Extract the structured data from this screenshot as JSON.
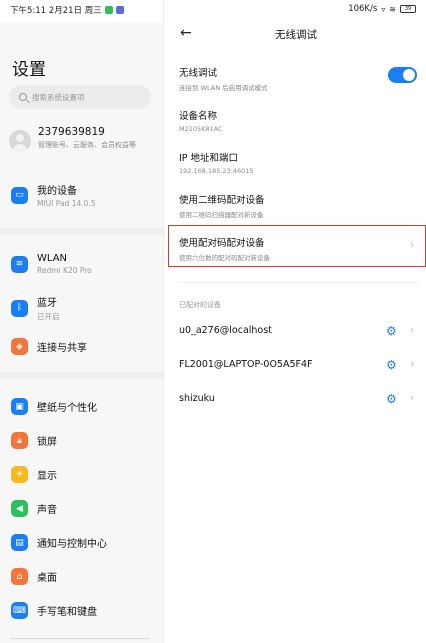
{
  "status": {
    "left": "下午5:11 2月21日 周三",
    "right_speed": "106K/s",
    "battery": "39"
  },
  "left_pane": {
    "title": "设置",
    "search_placeholder": "搜索系统设置项",
    "account": {
      "name": "2379639819",
      "sub": "管理账号、云服务、会员权益等"
    },
    "device": {
      "label": "我的设备",
      "sub": "MIUI Pad 14.0.5"
    },
    "items": [
      {
        "label": "WLAN",
        "sub": "Redmi K20 Pro",
        "icon": "wifi-icon",
        "color": "#1b7ef2"
      },
      {
        "label": "蓝牙",
        "sub": "已开启",
        "icon": "bluetooth-icon",
        "color": "#1b7ef2"
      },
      {
        "label": "连接与共享",
        "sub": "",
        "icon": "share-icon",
        "color": "#f2753a"
      },
      {
        "label": "壁纸与个性化",
        "sub": "",
        "icon": "wallpaper-icon",
        "color": "#1b7ef2"
      },
      {
        "label": "锁屏",
        "sub": "",
        "icon": "lock-icon",
        "color": "#f2753a"
      },
      {
        "label": "显示",
        "sub": "",
        "icon": "sun-icon",
        "color": "#f6b920"
      },
      {
        "label": "声音",
        "sub": "",
        "icon": "speaker-icon",
        "color": "#2fbf5c"
      },
      {
        "label": "通知与控制中心",
        "sub": "",
        "icon": "notification-icon",
        "color": "#1b7ef2"
      },
      {
        "label": "桌面",
        "sub": "",
        "icon": "home-icon",
        "color": "#f2753a"
      },
      {
        "label": "手写笔和键盘",
        "sub": "",
        "icon": "keyboard-icon",
        "color": "#1b7ef2"
      }
    ]
  },
  "right_pane": {
    "back_icon": "back-arrow-icon",
    "title": "无线调试",
    "wireless_debug": {
      "label": "无线调试",
      "sub": "连接到 WLAN 后启用调试模式",
      "enabled": true
    },
    "device_name": {
      "label": "设备名称",
      "value": "M2105K81AC"
    },
    "ip_port": {
      "label": "IP 地址和端口",
      "value": "192.168.185.23:46015"
    },
    "qr_pair": {
      "label": "使用二维码配对设备",
      "sub": "使用二维码扫描器配对新设备"
    },
    "code_pair": {
      "label": "使用配对码配对设备",
      "sub": "使用六位数的配对码配对新设备"
    },
    "paired_label": "已配对的设备",
    "paired_devices": [
      "u0_a276@localhost",
      "FL2001@LAPTOP-0O5A5F4F",
      "shizuku"
    ]
  }
}
